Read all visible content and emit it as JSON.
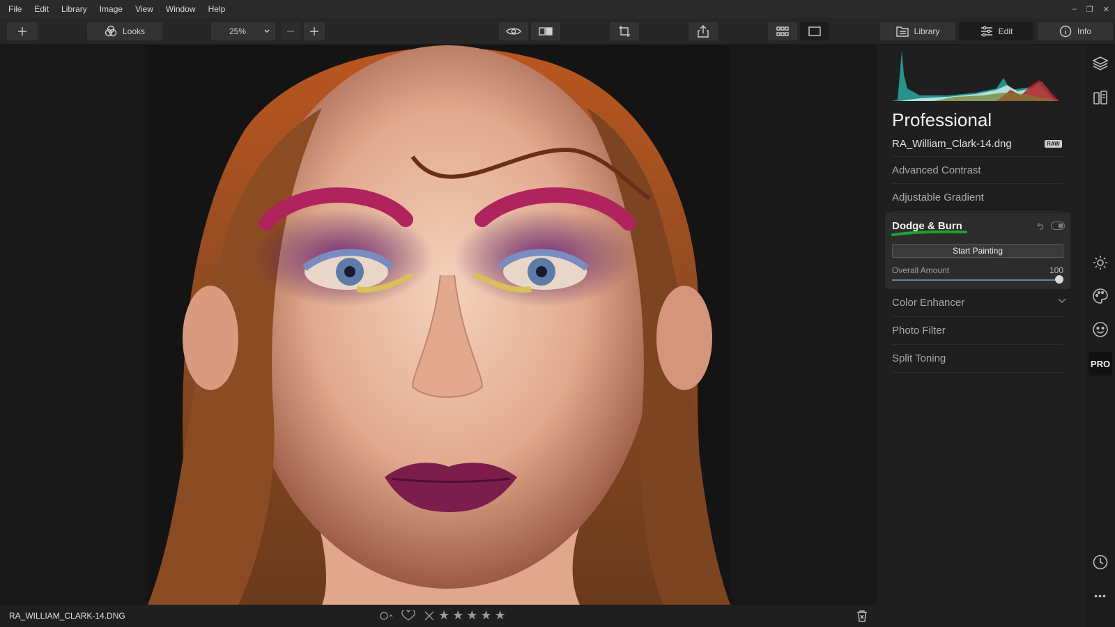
{
  "menu": [
    "File",
    "Edit",
    "Library",
    "Image",
    "View",
    "Window",
    "Help"
  ],
  "window_controls": [
    "–",
    "❐",
    "✕"
  ],
  "toolbar": {
    "looks_label": "Looks",
    "zoom_value": "25%",
    "tabs": [
      {
        "label": "Library"
      },
      {
        "label": "Edit"
      },
      {
        "label": "Info"
      }
    ]
  },
  "panel": {
    "preset_title": "Professional",
    "file_name": "RA_William_Clark-14.dng",
    "raw_badge": "RAW",
    "tools_before": [
      {
        "label": "Advanced Contrast"
      },
      {
        "label": "Adjustable Gradient"
      }
    ],
    "active_tool": {
      "title": "Dodge & Burn",
      "button": "Start Painting",
      "amount_label": "Overall Amount",
      "amount_value": "100",
      "amount_fraction": 1.0
    },
    "tools_after": [
      {
        "label": "Color Enhancer"
      },
      {
        "label": "Photo Filter"
      },
      {
        "label": "Split Toning"
      }
    ]
  },
  "rail": {
    "pro_label": "PRO",
    "more_label": "•••"
  },
  "status": {
    "file_name": "RA_WILLIAM_CLARK-14.DNG"
  },
  "colors": {
    "highlight_green": "#1fa32b",
    "slider_track": "#6a7ea8"
  }
}
